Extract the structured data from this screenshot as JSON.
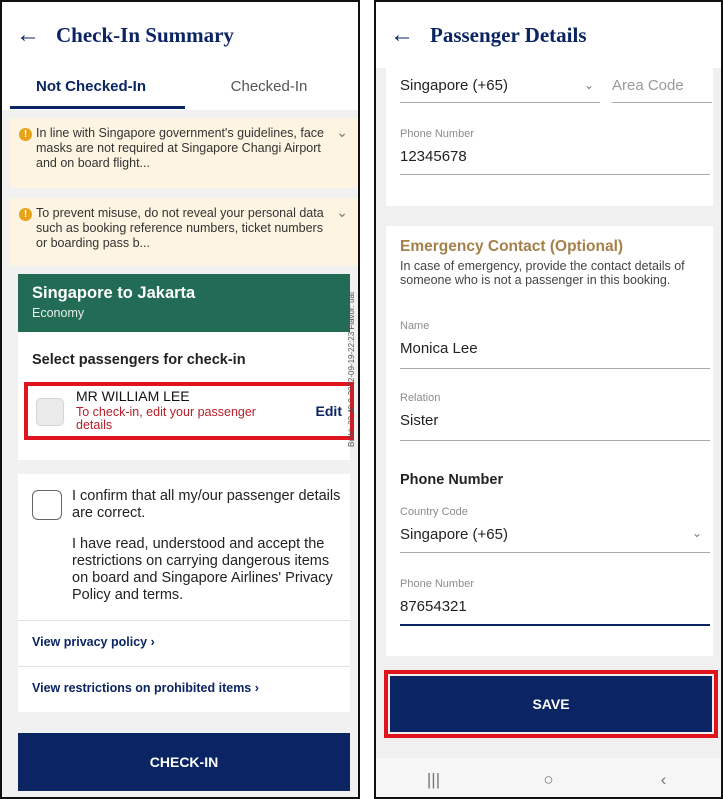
{
  "left": {
    "title": "Check-In Summary",
    "tabs": [
      {
        "label": "Not Checked-In"
      },
      {
        "label": "Checked-In"
      }
    ],
    "notices": [
      {
        "text": "In line with Singapore government's guidelines, face masks are not required at Singapore Changi Airport and on board flight..."
      },
      {
        "text": "To prevent misuse, do not reveal your personal data such as booking reference numbers, ticket numbers or boarding pass b..."
      }
    ],
    "flight": {
      "route": "Singapore to Jakarta",
      "cabin": "Economy",
      "select_title": "Select passengers for check-in"
    },
    "passenger": {
      "name": "MR WILLIAM LEE",
      "note": "To check-in, edit your passenger details",
      "edit_label": "Edit"
    },
    "build": "Build: 22.40.0-2022-09-19-22:23 Flavor: uat",
    "confirm": {
      "text": "I confirm that all my/our passenger details are correct.",
      "restrictions": "I have read, understood and accept the restrictions on carrying dangerous items on board and Singapore Airlines' Privacy Policy and terms."
    },
    "links": [
      {
        "label": "View privacy policy ›"
      },
      {
        "label": "View restrictions on prohibited items ›"
      }
    ],
    "checkin_button": "CHECK-IN"
  },
  "right": {
    "title": "Passenger Details",
    "country_code_top": "Singapore (+65)",
    "area_code_placeholder": "Area Code",
    "phone_label": "Phone Number",
    "phone_value": "12345678",
    "emergency": {
      "title": "Emergency Contact (Optional)",
      "description": "In case of emergency, provide the contact details of someone who is not a passenger in this booking.",
      "name_label": "Name",
      "name_value": "Monica Lee",
      "relation_label": "Relation",
      "relation_value": "Sister",
      "phone_section_title": "Phone Number",
      "country_label": "Country Code",
      "country_value": "Singapore (+65)",
      "phone_label": "Phone Number",
      "phone_value": "87654321"
    },
    "save_button": "SAVE",
    "nav": {
      "recent": "|||",
      "home": "○",
      "back": "‹"
    }
  },
  "colors": {
    "navy": "#0b2463",
    "green": "#226b54",
    "highlight_red": "#e0141e",
    "notice_bg": "#fdf4e1",
    "gold": "#a5804a"
  },
  "icons": [
    "back-arrow-icon",
    "warning-icon",
    "chevron-down-icon"
  ]
}
